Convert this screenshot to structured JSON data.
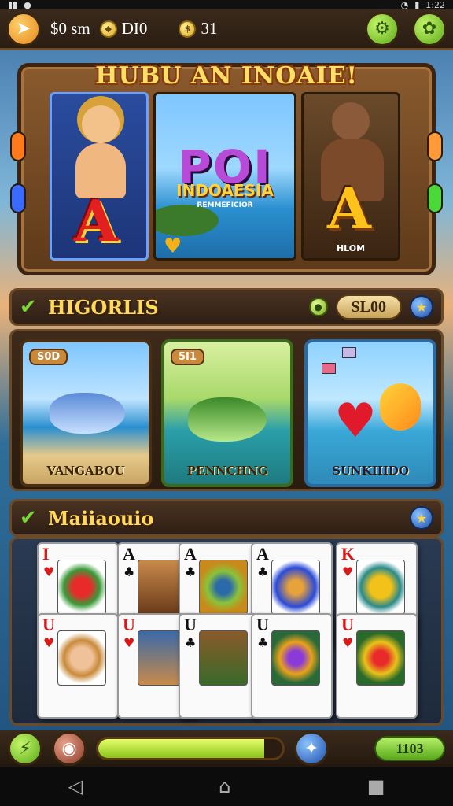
{
  "status_bar": {
    "time": "1:22"
  },
  "top_bar": {
    "money_label": "$0 sm",
    "gems_label": "DI0",
    "coins_label": "31"
  },
  "banner": {
    "title": "HUBU AN INOAIE!",
    "mid_logo": "POI",
    "mid_subtitle": "INDOAESIA",
    "mid_subtitle2": "REMMEFICIOR",
    "right_caption": "HLOM",
    "left_letter": "A",
    "right_letter": "A"
  },
  "section1": {
    "title": "HIGORLIS",
    "pill_value": "SL00"
  },
  "tiles": [
    {
      "badge": "S0D",
      "label": "VANGABOU"
    },
    {
      "badge": "5I1",
      "label": "PENNCHNG"
    },
    {
      "badge": "",
      "label": "SUNKIIIDO"
    }
  ],
  "section2": {
    "title": "Maiiaouio"
  },
  "cards": [
    {
      "rank": "I",
      "suit": "♥",
      "color": "red"
    },
    {
      "rank": "A",
      "suit": "♣",
      "color": "black"
    },
    {
      "rank": "A",
      "suit": "♣",
      "color": "black"
    },
    {
      "rank": "A",
      "suit": "♣",
      "color": "black"
    },
    {
      "rank": "K",
      "suit": "♥",
      "color": "red"
    },
    {
      "rank": "U",
      "suit": "♥",
      "color": "red"
    },
    {
      "rank": "U",
      "suit": "♥",
      "color": "red"
    },
    {
      "rank": "U",
      "suit": "♣",
      "color": "black"
    },
    {
      "rank": "U",
      "suit": "♣",
      "color": "black"
    },
    {
      "rank": "U",
      "suit": "♥",
      "color": "red"
    }
  ],
  "bottom_bar": {
    "progress": 0.9,
    "right_value": "1103"
  },
  "icons": {
    "back": "back-arrow-icon",
    "settings": "gear-icon",
    "menu": "flower-menu-icon",
    "nav_back": "triangle-back-icon",
    "nav_home": "home-icon",
    "nav_recent": "square-recent-icon"
  },
  "colors": {
    "accent_gold": "#ffd95a",
    "accent_green": "#7ad83a",
    "frame_brown": "#6b4a2a"
  }
}
